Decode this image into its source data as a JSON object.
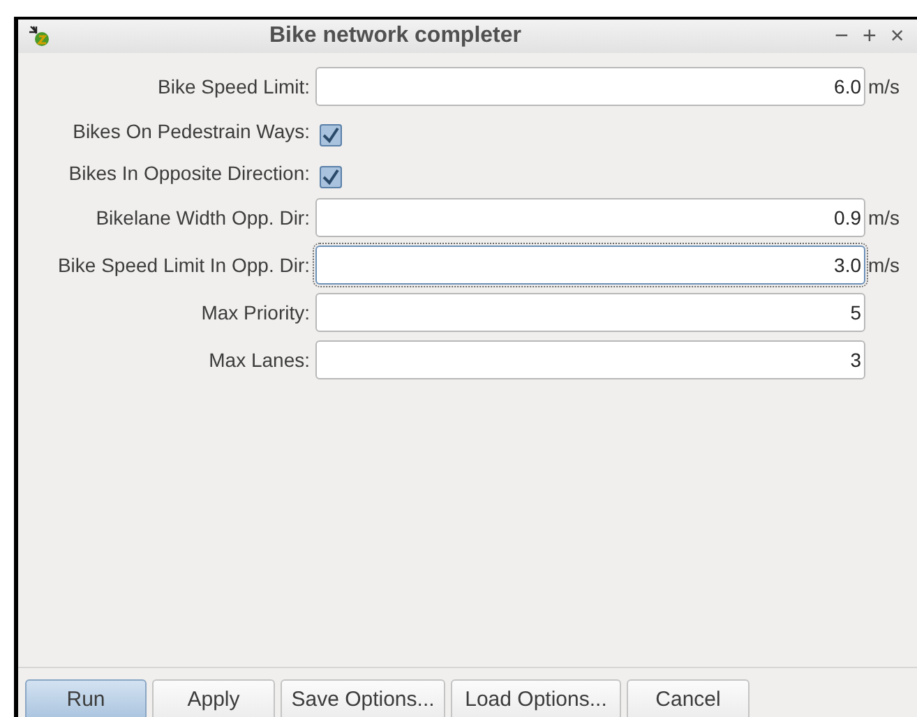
{
  "window": {
    "title": "Bike network completer",
    "controls": [
      "−",
      "+",
      "×"
    ]
  },
  "rows": [
    {
      "kind": "number",
      "label": "Bike Speed Limit:",
      "value": "6.0",
      "unit": "m/s",
      "focused": false
    },
    {
      "kind": "checkbox",
      "label": "Bikes On Pedestrain Ways:",
      "checked": true
    },
    {
      "kind": "checkbox",
      "label": "Bikes In Opposite Direction:",
      "checked": true
    },
    {
      "kind": "number",
      "label": "Bikelane Width Opp. Dir:",
      "value": "0.9",
      "unit": "m/s",
      "focused": false
    },
    {
      "kind": "number",
      "label": "Bike Speed Limit In Opp. Dir:",
      "value": "3.0",
      "unit": "m/s",
      "focused": true
    },
    {
      "kind": "number",
      "label": "Max Priority:",
      "value": "5",
      "focused": false
    },
    {
      "kind": "number",
      "label": "Max Lanes:",
      "value": "3",
      "focused": false
    }
  ],
  "buttons": [
    {
      "label": "Run",
      "default": true
    },
    {
      "label": "Apply",
      "default": false
    },
    {
      "label": "Save Options...",
      "default": false
    },
    {
      "label": "Load Options...",
      "default": false
    },
    {
      "label": "Cancel",
      "default": false
    }
  ]
}
